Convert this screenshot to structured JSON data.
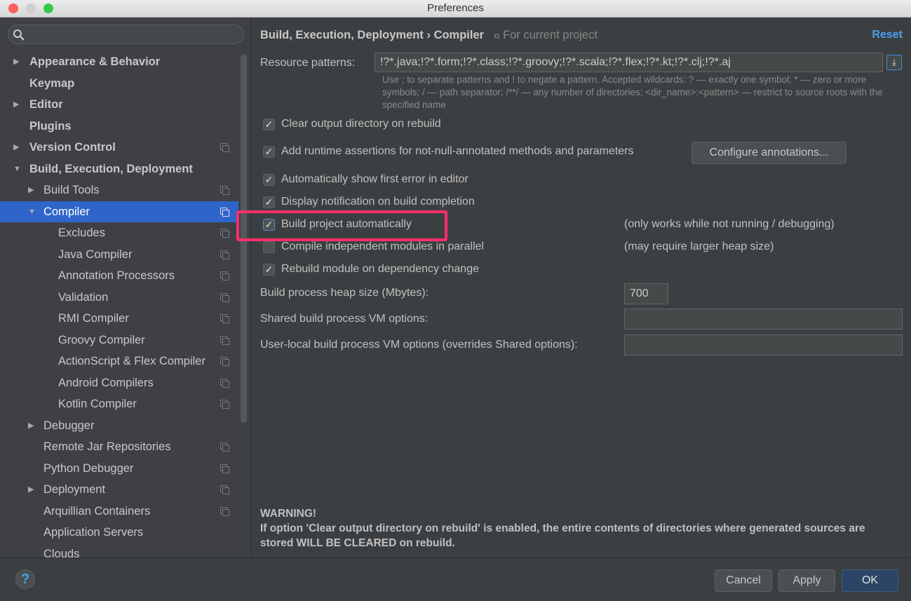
{
  "window": {
    "title": "Preferences"
  },
  "sidebar": {
    "search_placeholder": "",
    "items": [
      {
        "label": "Appearance & Behavior",
        "level": 0,
        "bold": true,
        "arrow": "right",
        "copy": false
      },
      {
        "label": "Keymap",
        "level": 0,
        "bold": true,
        "arrow": "",
        "copy": false
      },
      {
        "label": "Editor",
        "level": 0,
        "bold": true,
        "arrow": "right",
        "copy": false
      },
      {
        "label": "Plugins",
        "level": 0,
        "bold": true,
        "arrow": "",
        "copy": false
      },
      {
        "label": "Version Control",
        "level": 0,
        "bold": true,
        "arrow": "right",
        "copy": true
      },
      {
        "label": "Build, Execution, Deployment",
        "level": 0,
        "bold": true,
        "arrow": "down",
        "copy": false
      },
      {
        "label": "Build Tools",
        "level": 1,
        "arrow": "right",
        "copy": true
      },
      {
        "label": "Compiler",
        "level": 1,
        "arrow": "down",
        "copy": true,
        "selected": true
      },
      {
        "label": "Excludes",
        "level": 2,
        "arrow": "",
        "copy": true
      },
      {
        "label": "Java Compiler",
        "level": 2,
        "arrow": "",
        "copy": true
      },
      {
        "label": "Annotation Processors",
        "level": 2,
        "arrow": "",
        "copy": true
      },
      {
        "label": "Validation",
        "level": 2,
        "arrow": "",
        "copy": true
      },
      {
        "label": "RMI Compiler",
        "level": 2,
        "arrow": "",
        "copy": true
      },
      {
        "label": "Groovy Compiler",
        "level": 2,
        "arrow": "",
        "copy": true
      },
      {
        "label": "ActionScript & Flex Compiler",
        "level": 2,
        "arrow": "",
        "copy": true
      },
      {
        "label": "Android Compilers",
        "level": 2,
        "arrow": "",
        "copy": true
      },
      {
        "label": "Kotlin Compiler",
        "level": 2,
        "arrow": "",
        "copy": true
      },
      {
        "label": "Debugger",
        "level": 1,
        "arrow": "right",
        "copy": false
      },
      {
        "label": "Remote Jar Repositories",
        "level": 1,
        "arrow": "",
        "copy": true
      },
      {
        "label": "Python Debugger",
        "level": 1,
        "arrow": "",
        "copy": true
      },
      {
        "label": "Deployment",
        "level": 1,
        "arrow": "right",
        "copy": true
      },
      {
        "label": "Arquillian Containers",
        "level": 1,
        "arrow": "",
        "copy": true
      },
      {
        "label": "Application Servers",
        "level": 1,
        "arrow": "",
        "copy": false
      },
      {
        "label": "Clouds",
        "level": 1,
        "arrow": "",
        "copy": false
      }
    ]
  },
  "header": {
    "breadcrumb_parent": "Build, Execution, Deployment",
    "breadcrumb_sep": "›",
    "breadcrumb_current": "Compiler",
    "scope": "For current project",
    "reset": "Reset"
  },
  "resource": {
    "label": "Resource patterns:",
    "value": "!?*.java;!?*.form;!?*.class;!?*.groovy;!?*.scala;!?*.flex;!?*.kt;!?*.clj;!?*.aj",
    "hint": "Use ; to separate patterns and ! to negate a pattern. Accepted wildcards: ? — exactly one symbol; * — zero or more symbols; / — path separator; /**/ — any number of directories; <dir_name>:<pattern> — restrict to source roots with the specified name"
  },
  "options": [
    {
      "label": "Clear output directory on rebuild",
      "checked": true,
      "note": ""
    },
    {
      "label": "Add runtime assertions for not-null-annotated methods and parameters",
      "checked": true,
      "note": ""
    },
    {
      "label": "Automatically show first error in editor",
      "checked": true,
      "note": ""
    },
    {
      "label": "Display notification on build completion",
      "checked": true,
      "note": ""
    },
    {
      "label": "Build project automatically",
      "checked": true,
      "note": "(only works while not running / debugging)"
    },
    {
      "label": "Compile independent modules in parallel",
      "checked": false,
      "note": "(may require larger heap size)"
    },
    {
      "label": "Rebuild module on dependency change",
      "checked": true,
      "note": ""
    }
  ],
  "configure_button": "Configure annotations...",
  "heap": {
    "label": "Build process heap size (Mbytes):",
    "value": "700"
  },
  "shared_vm": {
    "label": "Shared build process VM options:",
    "value": ""
  },
  "local_vm": {
    "label": "User-local build process VM options (overrides Shared options):",
    "value": ""
  },
  "warning": {
    "title": "WARNING!",
    "text": "If option 'Clear output directory on rebuild' is enabled, the entire contents of directories where generated sources are stored WILL BE CLEARED on rebuild."
  },
  "footer": {
    "help": "?",
    "cancel": "Cancel",
    "apply": "Apply",
    "ok": "OK"
  },
  "colors": {
    "highlight": "#fb2f6c",
    "selection": "#2f65ca",
    "link": "#4a9ff0"
  }
}
